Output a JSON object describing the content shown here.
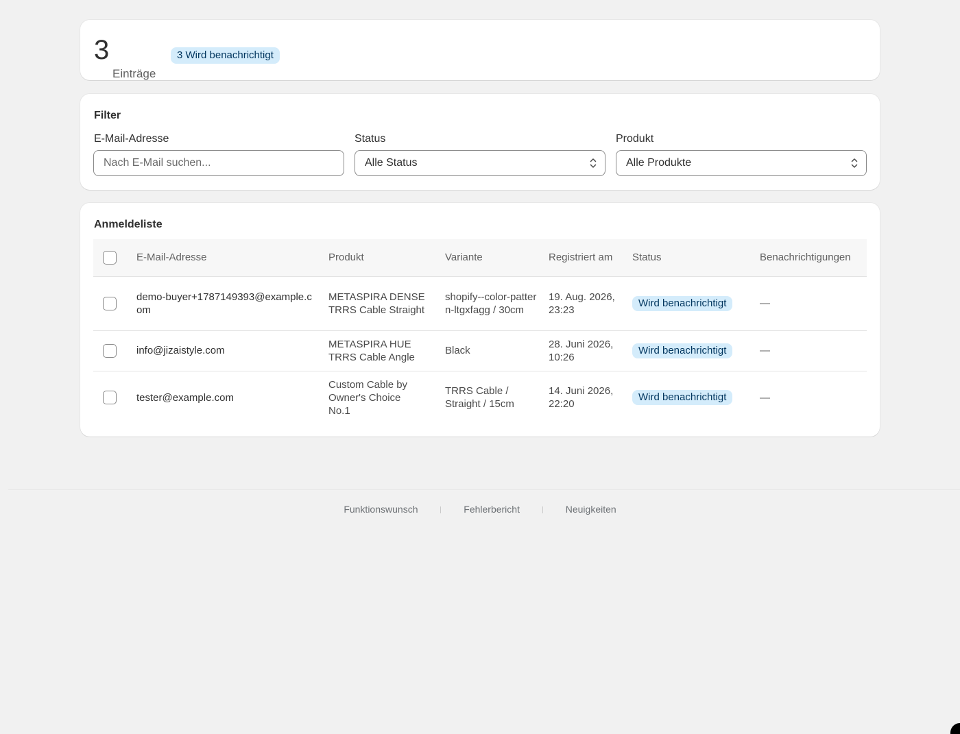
{
  "summary": {
    "count": "3",
    "count_label": "Einträge",
    "badge": "3 Wird benachrichtigt"
  },
  "filter": {
    "title": "Filter",
    "email_label": "E-Mail-Adresse",
    "email_placeholder": "Nach E-Mail suchen...",
    "status_label": "Status",
    "status_value": "Alle Status",
    "product_label": "Produkt",
    "product_value": "Alle Produkte"
  },
  "list": {
    "title": "Anmeldeliste",
    "columns": [
      "E-Mail-Adresse",
      "Produkt",
      "Variante",
      "Registriert am",
      "Status",
      "Benachrichtigungen"
    ],
    "rows": [
      {
        "email": "demo-buyer+1787149393@example.com",
        "product": "METASPIRA DENSE TRRS Cable Straight",
        "variant": "shopify--color-pattern-ltgxfagg / 30cm",
        "registered": "19. Aug. 2026, 23:23",
        "status": "Wird benachrichtigt",
        "notifications": "—"
      },
      {
        "email": "info@jizaistyle.com",
        "product": "METASPIRA HUE TRRS Cable Angle",
        "variant": "Black",
        "registered": "28. Juni 2026, 10:26",
        "status": "Wird benachrichtigt",
        "notifications": "—"
      },
      {
        "email": "tester@example.com",
        "product": "Custom Cable by Owner's Choice No.1",
        "variant": "TRRS Cable / Straight / 15cm",
        "registered": "14. Juni 2026, 22:20",
        "status": "Wird benachrichtigt",
        "notifications": "—"
      }
    ]
  },
  "footer": {
    "links": [
      "Funktionswunsch",
      "Fehlerbericht",
      "Neuigkeiten"
    ]
  },
  "colors": {
    "badge_bg": "#d4ecfb",
    "badge_text": "#00355e",
    "page_bg": "#f1f1f1"
  }
}
